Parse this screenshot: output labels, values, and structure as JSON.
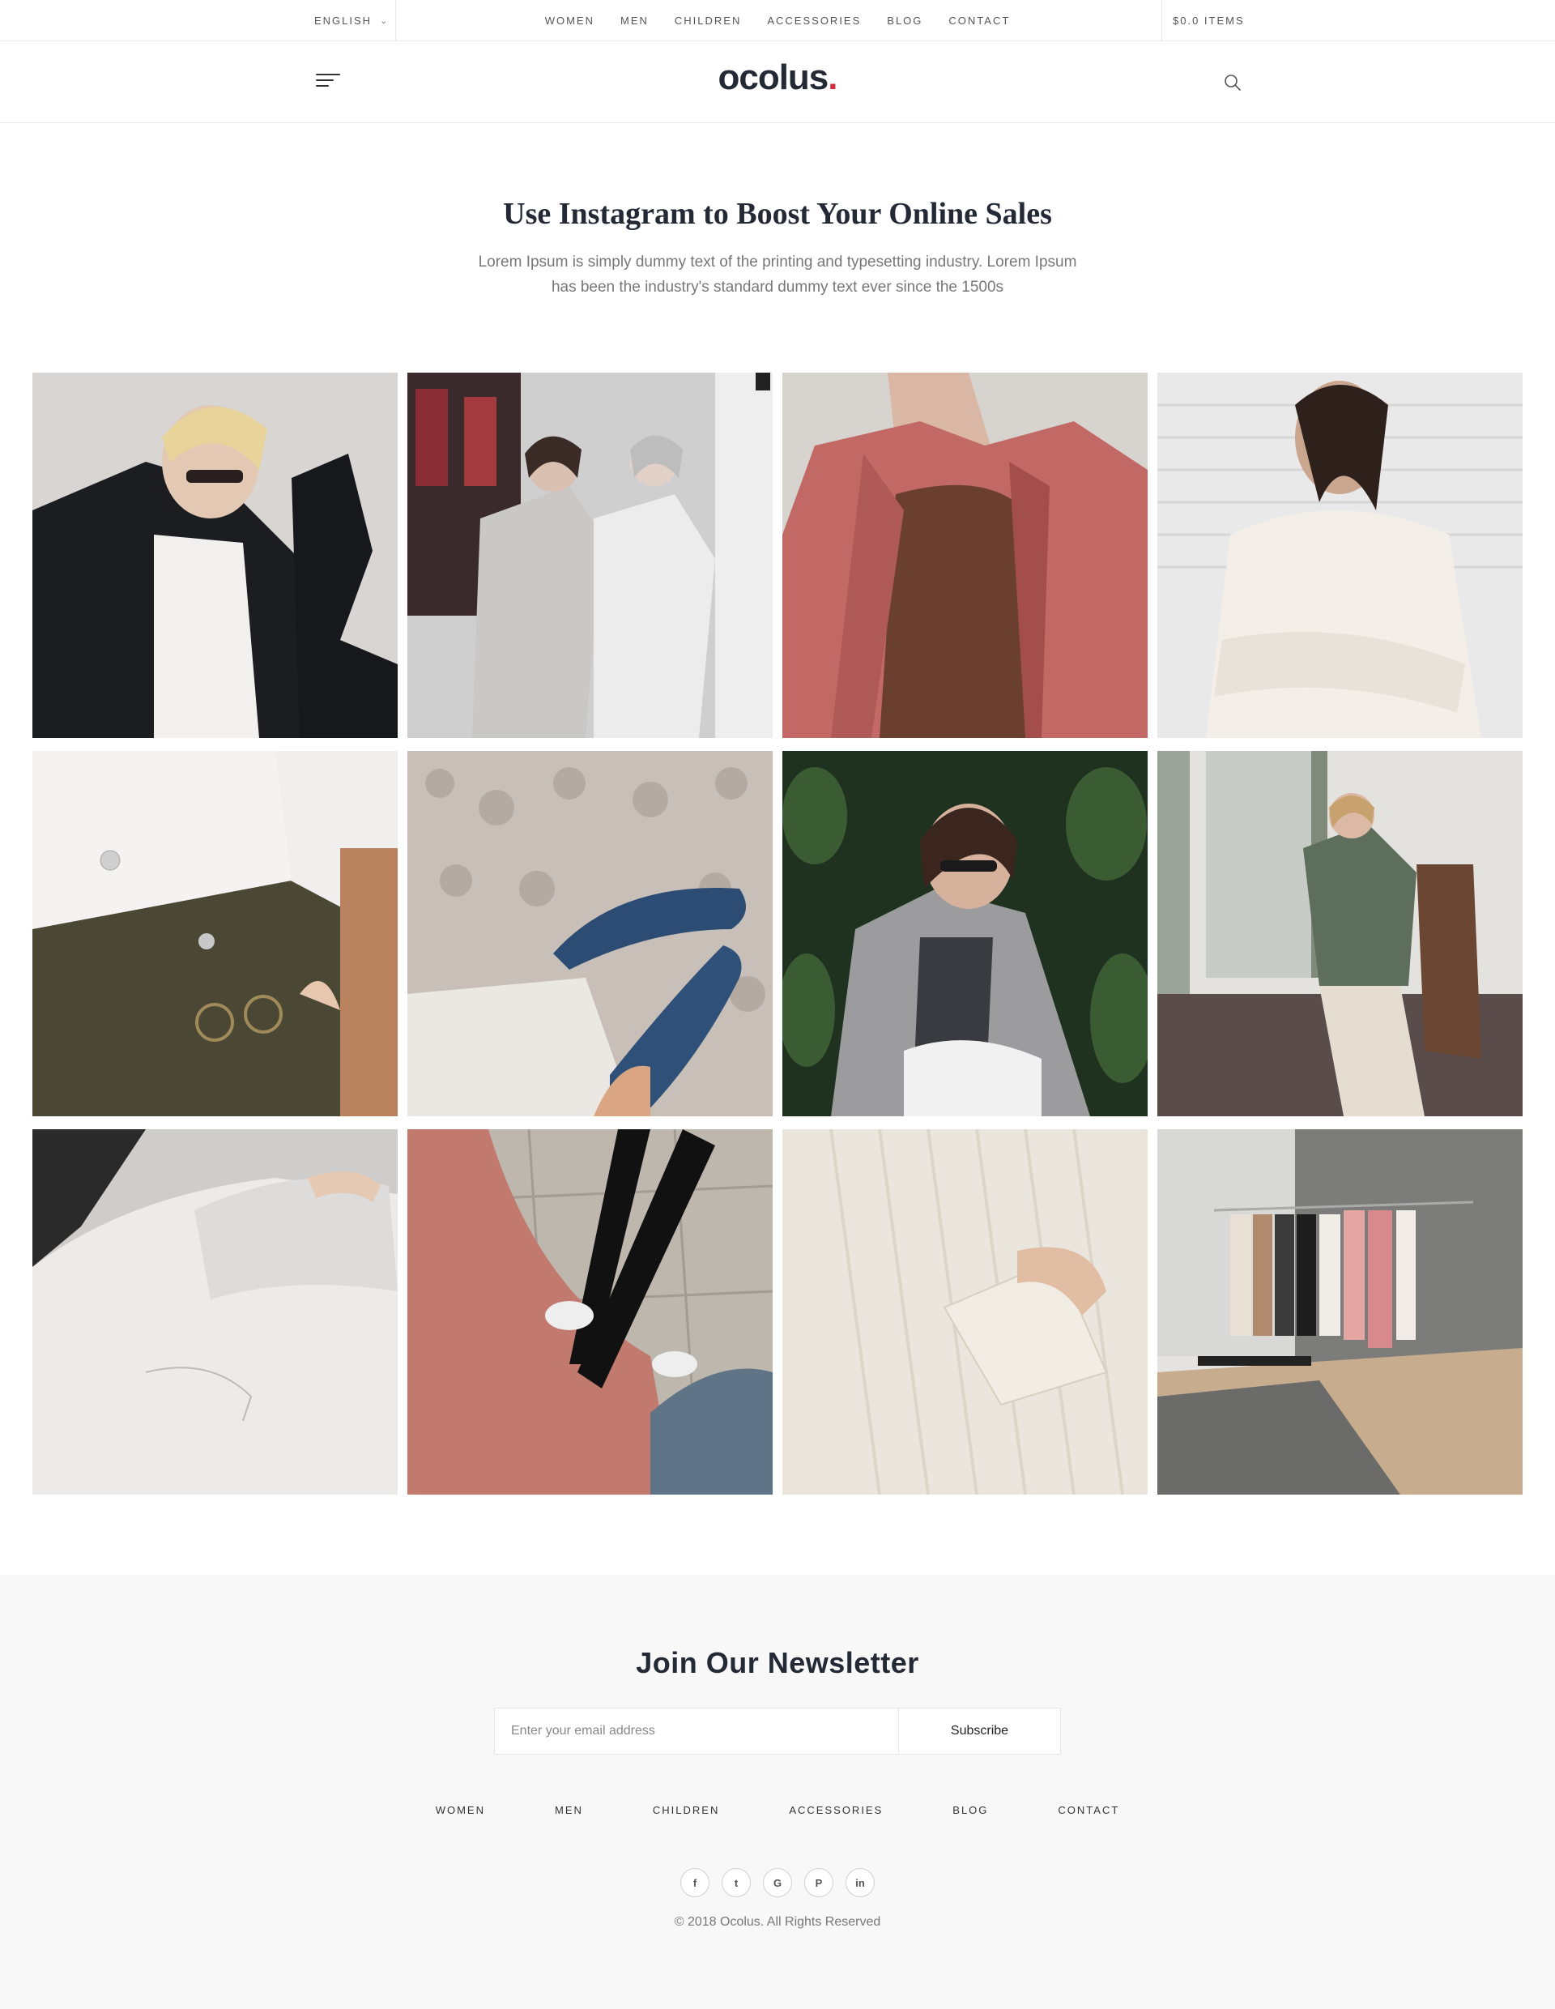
{
  "topbar": {
    "language": "ENGLISH",
    "nav": [
      "WOMEN",
      "MEN",
      "CHILDREN",
      "ACCESSORIES",
      "BLOG",
      "CONTACT"
    ],
    "cart": "$0.0 ITEMS"
  },
  "header": {
    "logo_text": "ocolus",
    "logo_dot": ".",
    "icons": [
      "menu-icon",
      "search-icon"
    ]
  },
  "intro": {
    "title": "Use Instagram to Boost Your Online Sales",
    "text": "Lorem Ipsum is simply dummy text of the printing and typesetting industry. Lorem Ipsum has been the industry's standard dummy text ever since the 1500s"
  },
  "gallery": {
    "photos": [
      "woman-black-blazer-sunglasses",
      "two-women-grey-coats-street",
      "pink-coat-closeup",
      "woman-white-sweater-brick-wall",
      "white-shirt-olive-pants-glasses",
      "blue-flats-on-rug",
      "woman-sunglasses-grey-jacket-plants",
      "woman-green-coat-chair",
      "white-coat-sleeve",
      "pink-coat-bicycle-sneakers",
      "cream-knit-sweater-sleeve",
      "clothing-rack-room"
    ]
  },
  "newsletter": {
    "title": "Join Our Newsletter",
    "placeholder": "Enter your email address",
    "button": "Subscribe"
  },
  "footer": {
    "nav": [
      "WOMEN",
      "MEN",
      "CHILDREN",
      "ACCESSORIES",
      "BLOG",
      "CONTACT"
    ],
    "socials": [
      {
        "icon": "facebook-icon",
        "glyph": "f"
      },
      {
        "icon": "twitter-icon",
        "glyph": "t"
      },
      {
        "icon": "google-icon",
        "glyph": "G"
      },
      {
        "icon": "pinterest-icon",
        "glyph": "P"
      },
      {
        "icon": "linkedin-icon",
        "glyph": "in"
      }
    ],
    "copyright": "© 2018 Ocolus. All Rights Reserved"
  },
  "colors": {
    "brand_dark": "#232a36",
    "logo_dot": "#d12c3a",
    "footer_bg": "#f8f8f8"
  }
}
